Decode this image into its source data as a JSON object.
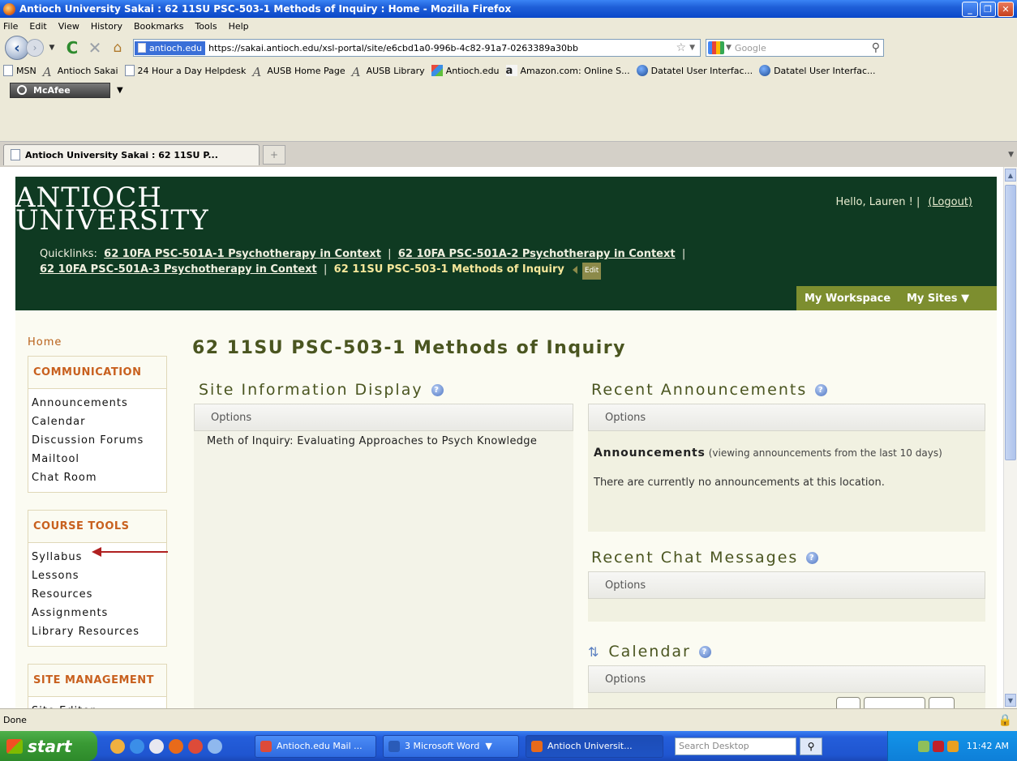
{
  "window": {
    "title": "Antioch University Sakai : 62 11SU PSC-503-1 Methods of Inquiry : Home - Mozilla Firefox"
  },
  "menu": [
    "File",
    "Edit",
    "View",
    "History",
    "Bookmarks",
    "Tools",
    "Help"
  ],
  "urlbar": {
    "site_badge": "antioch.edu",
    "url": "https://sakai.antioch.edu/xsl-portal/site/e6cbd1a0-996b-4c82-91a7-0263389a30bb"
  },
  "searchbar": {
    "placeholder": "Google"
  },
  "bookmarks": [
    {
      "label": "MSN",
      "icon": "page-icon"
    },
    {
      "label": "Antioch Sakai",
      "icon": "a-icon"
    },
    {
      "label": "24 Hour a Day Helpdesk",
      "icon": "page-icon"
    },
    {
      "label": "AUSB Home Page",
      "icon": "a-icon"
    },
    {
      "label": "AUSB Library",
      "icon": "a-icon"
    },
    {
      "label": "Antioch.edu",
      "icon": "people-icon"
    },
    {
      "label": "Amazon.com: Online S...",
      "icon": "amazon-icon"
    },
    {
      "label": "Datatel User Interfac...",
      "icon": "datatel-icon"
    },
    {
      "label": "Datatel User Interfac...",
      "icon": "datatel-icon"
    }
  ],
  "mcafee": {
    "label": "McAfee"
  },
  "tab": {
    "label": "Antioch University Sakai : 62 11SU P..."
  },
  "header": {
    "logo_line1": "ANTIOCH",
    "logo_line2": "UNIVERSITY",
    "hello": "Hello, Lauren ! |",
    "logout": "(Logout)",
    "quicklinks_label": "Quicklinks:",
    "quicklinks": [
      "62 10FA PSC-501A-1 Psychotherapy in Context",
      "62 10FA PSC-501A-2 Psychotherapy in Context",
      "62 10FA PSC-501A-3 Psychotherapy in Context"
    ],
    "current_site": "62 11SU PSC-503-1 Methods of Inquiry",
    "edit": "Edit",
    "my_workspace": "My Workspace",
    "my_sites": "My Sites"
  },
  "sidebar": {
    "home": "Home",
    "communication": {
      "title": "COMMUNICATION",
      "items": [
        "Announcements",
        "Calendar",
        "Discussion Forums",
        "Mailtool",
        "Chat Room"
      ]
    },
    "course_tools": {
      "title": "COURSE TOOLS",
      "items": [
        "Syllabus",
        "Lessons",
        "Resources",
        "Assignments",
        "Library Resources"
      ]
    },
    "site_management": {
      "title": "SITE MANAGEMENT",
      "items": [
        "Site Editor"
      ]
    }
  },
  "main": {
    "page_title": "62 11SU PSC-503-1 Methods of Inquiry",
    "site_info": {
      "title": "Site Information Display",
      "options": "Options",
      "text": "Meth of Inquiry: Evaluating Approaches to Psych Knowledge"
    },
    "announcements": {
      "title": "Recent Announcements",
      "options": "Options",
      "heading": "Announcements",
      "subheading": "(viewing announcements from the last 10 days)",
      "body": "There are currently no announcements at this location."
    },
    "chat": {
      "title": "Recent Chat Messages",
      "options": "Options"
    },
    "calendar": {
      "title": "Calendar",
      "options": "Options"
    }
  },
  "status": {
    "text": "Done"
  },
  "taskbar": {
    "start": "start",
    "tasks": [
      "Antioch.edu Mail ...",
      "3 Microsoft Word",
      "Antioch Universit..."
    ],
    "search_placeholder": "Search Desktop",
    "clock": "11:42 AM"
  },
  "colors": {
    "header_bg": "#0f3a22",
    "accent_orange": "#c8601e",
    "title_olive": "#4a5520",
    "workspace_btn": "#7d8e2f"
  }
}
